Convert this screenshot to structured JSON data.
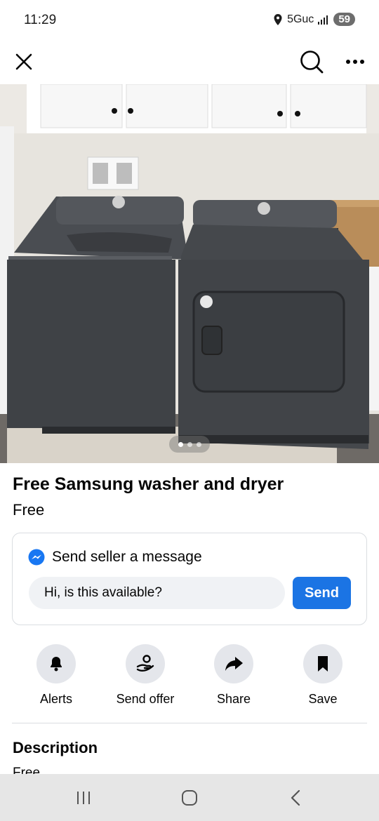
{
  "status_bar": {
    "time": "11:29",
    "network": "5Guc",
    "battery": "59"
  },
  "nav": {
    "close_icon": "close-icon",
    "search_icon": "search-icon",
    "more_icon": "more-horizontal-icon"
  },
  "photo": {
    "slide_count": 3,
    "active_index": 0
  },
  "listing": {
    "title": "Free Samsung washer and dryer",
    "price": "Free"
  },
  "message": {
    "header": "Send seller a message",
    "input_value": "Hi, is this available?",
    "send_label": "Send"
  },
  "actions": [
    {
      "label": "Alerts",
      "icon": "bell-icon"
    },
    {
      "label": "Send offer",
      "icon": "offer-hand-icon"
    },
    {
      "label": "Share",
      "icon": "share-arrow-icon"
    },
    {
      "label": "Save",
      "icon": "bookmark-icon"
    }
  ],
  "description": {
    "heading": "Description",
    "body": "Free"
  },
  "colors": {
    "accent": "#1b74e4",
    "action_bg": "#e4e6eb",
    "input_bg": "#f0f2f5",
    "system_nav_bg": "#e6e6e6"
  }
}
